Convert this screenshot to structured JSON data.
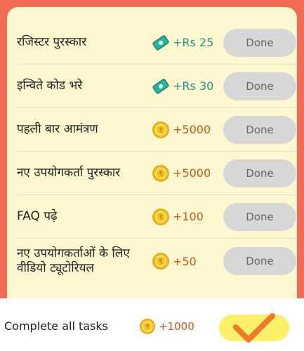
{
  "tasks": [
    {
      "label": "रजिस्टर पुरस्कार",
      "reward_type": "cash",
      "reward": "+Rs 25",
      "button": "Done",
      "icon": "cash-icon"
    },
    {
      "label": "इन्विते कोड भरे",
      "reward_type": "cash",
      "reward": "+Rs 30",
      "button": "Done",
      "icon": "cash-icon"
    },
    {
      "label": "पहली बार आमंत्रण",
      "reward_type": "coin",
      "reward": "+5000",
      "button": "Done",
      "icon": "coin-icon"
    },
    {
      "label": "नए उपयोगकर्ता पुरस्कार",
      "reward_type": "coin",
      "reward": "+5000",
      "button": "Done",
      "icon": "coin-icon"
    },
    {
      "label": "FAQ पढ़े",
      "reward_type": "coin",
      "reward": "+100",
      "button": "Done",
      "icon": "coin-icon"
    },
    {
      "label": "नए उपयोगकर्ताओं के लिए वीडियो ट्यूटोरियल",
      "reward_type": "coin",
      "reward": "+50",
      "button": "Done",
      "icon": "coin-icon"
    }
  ],
  "footer": {
    "label": "Complete all tasks",
    "reward": "+1000",
    "icon": "coin-icon",
    "status_icon": "checkmark-icon"
  },
  "colors": {
    "background": "#f26b55",
    "panel": "#fff7d0",
    "cash_text": "#1a9a86",
    "coin_text": "#c8581e",
    "done_button": "#d7d7d7",
    "check_button": "#fbf06a",
    "checkmark": "#ee7a2a"
  }
}
